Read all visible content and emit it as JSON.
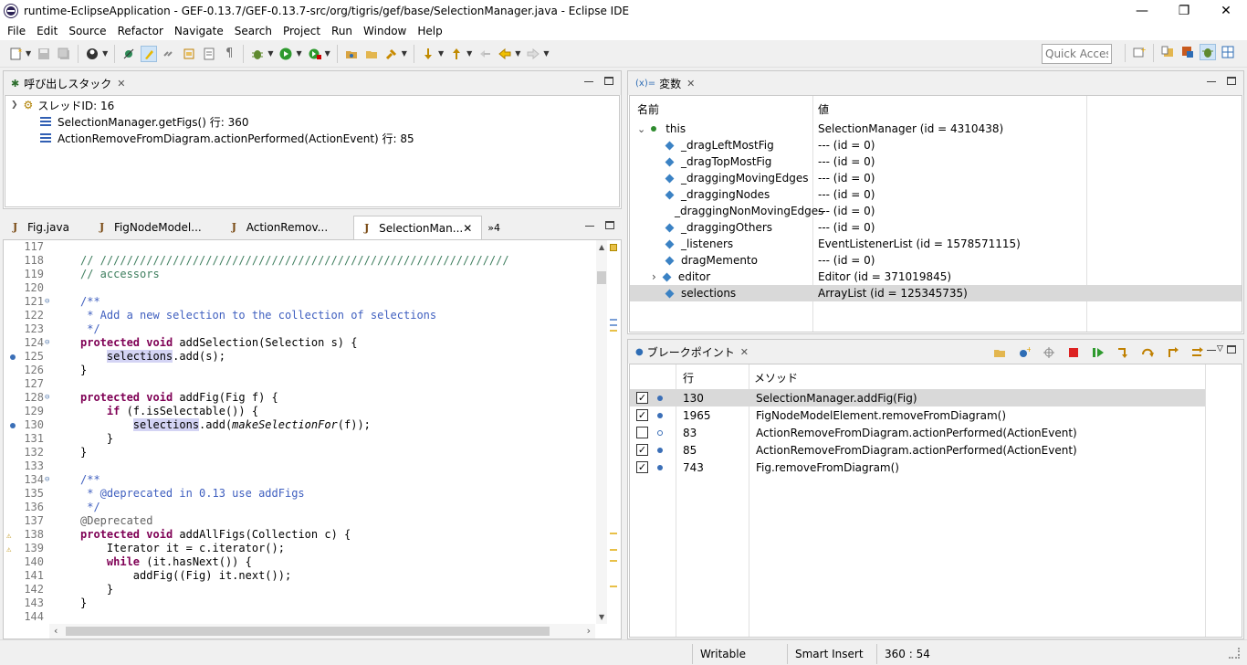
{
  "window": {
    "title": "runtime-EclipseApplication - GEF-0.13.7/GEF-0.13.7-src/org/tigris/gef/base/SelectionManager.java - Eclipse IDE",
    "minimize": "—",
    "restore": "❐",
    "close": "✕"
  },
  "menu": [
    "File",
    "Edit",
    "Source",
    "Refactor",
    "Navigate",
    "Search",
    "Project",
    "Run",
    "Window",
    "Help"
  ],
  "toolbar": {
    "quick_access_placeholder": "Quick Access"
  },
  "callstack": {
    "tab_label": "呼び出しスタック",
    "thread": "スレッドID: 16",
    "frames": [
      "SelectionManager.getFigs() 行: 360",
      "ActionRemoveFromDiagram.actionPerformed(ActionEvent) 行: 85"
    ]
  },
  "editor": {
    "tabs": [
      "Fig.java",
      "FigNodeModel...",
      "ActionRemov...",
      "SelectionMan..."
    ],
    "overflow": "»4",
    "lines": [
      {
        "n": "117",
        "t": ""
      },
      {
        "n": "118",
        "t": "// //////////////////////////////////////////////////////////////"
      },
      {
        "n": "119",
        "t": "// accessors"
      },
      {
        "n": "120",
        "t": ""
      },
      {
        "n": "121",
        "t": "/**"
      },
      {
        "n": "122",
        "t": " * Add a new selection to the collection of selections"
      },
      {
        "n": "123",
        "t": " */"
      },
      {
        "n": "124",
        "t": "protected void addSelection(Selection s) {"
      },
      {
        "n": "125",
        "t": "    selections.add(s);"
      },
      {
        "n": "126",
        "t": "}"
      },
      {
        "n": "127",
        "t": ""
      },
      {
        "n": "128",
        "t": "protected void addFig(Fig f) {"
      },
      {
        "n": "129",
        "t": "    if (f.isSelectable()) {"
      },
      {
        "n": "130",
        "t": "        selections.add(makeSelectionFor(f));"
      },
      {
        "n": "131",
        "t": "    }"
      },
      {
        "n": "132",
        "t": "}"
      },
      {
        "n": "133",
        "t": ""
      },
      {
        "n": "134",
        "t": "/**"
      },
      {
        "n": "135",
        "t": " * @deprecated in 0.13 use addFigs"
      },
      {
        "n": "136",
        "t": " */"
      },
      {
        "n": "137",
        "t": "@Deprecated"
      },
      {
        "n": "138",
        "t": "protected void addAllFigs(Collection c) {"
      },
      {
        "n": "139",
        "t": "    Iterator it = c.iterator();"
      },
      {
        "n": "140",
        "t": "    while (it.hasNext()) {"
      },
      {
        "n": "141",
        "t": "        addFig((Fig) it.next());"
      },
      {
        "n": "142",
        "t": "    }"
      },
      {
        "n": "143",
        "t": "}"
      },
      {
        "n": "144",
        "t": ""
      }
    ]
  },
  "variables": {
    "tab_label": "変数",
    "tab_prefix": "(x)=",
    "col_name": "名前",
    "col_value": "値",
    "rows": [
      {
        "name": "this",
        "value": "SelectionManager (id = 4310438)"
      },
      {
        "name": "_dragLeftMostFig",
        "value": "--- (id = 0)"
      },
      {
        "name": "_dragTopMostFig",
        "value": "--- (id = 0)"
      },
      {
        "name": "_draggingMovingEdges",
        "value": "--- (id = 0)"
      },
      {
        "name": "_draggingNodes",
        "value": "--- (id = 0)"
      },
      {
        "name": "_draggingNonMovingEdges",
        "value": "--- (id = 0)"
      },
      {
        "name": "_draggingOthers",
        "value": "--- (id = 0)"
      },
      {
        "name": "_listeners",
        "value": "EventListenerList (id = 1578571115)"
      },
      {
        "name": "dragMemento",
        "value": "--- (id = 0)"
      },
      {
        "name": "editor",
        "value": "Editor (id = 371019845)"
      },
      {
        "name": "selections",
        "value": "ArrayList (id = 125345735)"
      }
    ]
  },
  "breakpoints": {
    "tab_label": "ブレークポイント",
    "col_line": "行",
    "col_method": "メソッド",
    "rows": [
      {
        "line": "130",
        "method": "SelectionManager.addFig(Fig)",
        "checked": true
      },
      {
        "line": "1965",
        "method": "FigNodeModelElement.removeFromDiagram()",
        "checked": true
      },
      {
        "line": "83",
        "method": "ActionRemoveFromDiagram.actionPerformed(ActionEvent)",
        "checked": false
      },
      {
        "line": "85",
        "method": "ActionRemoveFromDiagram.actionPerformed(ActionEvent)",
        "checked": true
      },
      {
        "line": "743",
        "method": "Fig.removeFromDiagram()",
        "checked": true
      }
    ]
  },
  "status": {
    "writable": "Writable",
    "insert_mode": "Smart Insert",
    "position": "360 : 54"
  }
}
